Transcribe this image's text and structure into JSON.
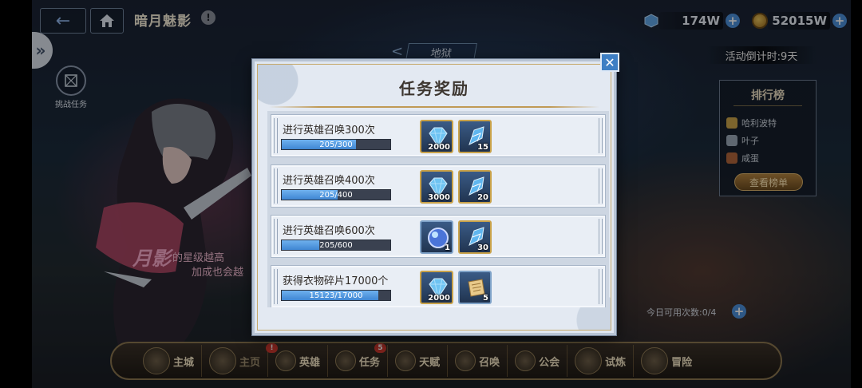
{
  "header": {
    "title": "暗月魅影",
    "info_glyph": "!",
    "back_glyph": "←",
    "currency_gem": "174W",
    "currency_coin": "52015W",
    "plus_glyph": "+"
  },
  "side": {
    "expand_glyph": "»",
    "challenge_label": "挑战任务",
    "hell_tab": "地狱",
    "hell_arrow": "<"
  },
  "event": {
    "countdown": "活动倒计时:9天",
    "promo_big": "月影",
    "promo_line1": "的星级越高",
    "promo_line2": "加成也会越",
    "uses_today": "今日可用次数:0/4"
  },
  "ranking": {
    "title": "排行榜",
    "entries": [
      "哈利波特",
      "叶子",
      "咸蛋"
    ],
    "view_button": "查看榜单",
    "badge_colors": [
      "#c9a24a",
      "#9aa6b5",
      "#b0653a"
    ]
  },
  "nav": {
    "items": [
      {
        "label": "主城",
        "icon": "city-icon"
      },
      {
        "label": "主页",
        "icon": "home-page-icon",
        "badge": "!"
      },
      {
        "label": "英雄",
        "icon": "hero-icon"
      },
      {
        "label": "任务",
        "icon": "task-icon",
        "badge": "5"
      },
      {
        "label": "天赋",
        "icon": "talent-icon"
      },
      {
        "label": "召唤",
        "icon": "summon-icon"
      },
      {
        "label": "公会",
        "icon": "guild-icon"
      },
      {
        "label": "试炼",
        "icon": "trial-icon"
      },
      {
        "label": "冒险",
        "icon": "adventure-icon"
      }
    ]
  },
  "modal": {
    "title": "任务奖励",
    "close_glyph": "✕",
    "tasks": [
      {
        "name": "进行英雄召唤300次",
        "progress_text": "205/300",
        "progress": 0.683,
        "rewards": [
          {
            "icon": "diamond-icon",
            "qty": "2000"
          },
          {
            "icon": "crystal-shard-icon",
            "qty": "15"
          }
        ]
      },
      {
        "name": "进行英雄召唤400次",
        "progress_text": "205/400",
        "progress": 0.5125,
        "rewards": [
          {
            "icon": "diamond-icon",
            "qty": "3000"
          },
          {
            "icon": "crystal-shard-icon",
            "qty": "20"
          }
        ]
      },
      {
        "name": "进行英雄召唤600次",
        "progress_text": "205/600",
        "progress": 0.342,
        "rewards": [
          {
            "icon": "orb-icon",
            "qty": "1"
          },
          {
            "icon": "crystal-shard-icon",
            "qty": "30"
          }
        ]
      },
      {
        "name": "获得衣物碎片17000个",
        "progress_text": "15123/17000",
        "progress": 0.89,
        "rewards": [
          {
            "icon": "diamond-icon",
            "qty": "2000"
          },
          {
            "icon": "scroll-icon",
            "qty": "5"
          }
        ]
      }
    ]
  },
  "colors": {
    "accent_blue": "#3f86d3",
    "gold_frame": "#c9a24a",
    "modal_bg": "#e3e9f2"
  }
}
